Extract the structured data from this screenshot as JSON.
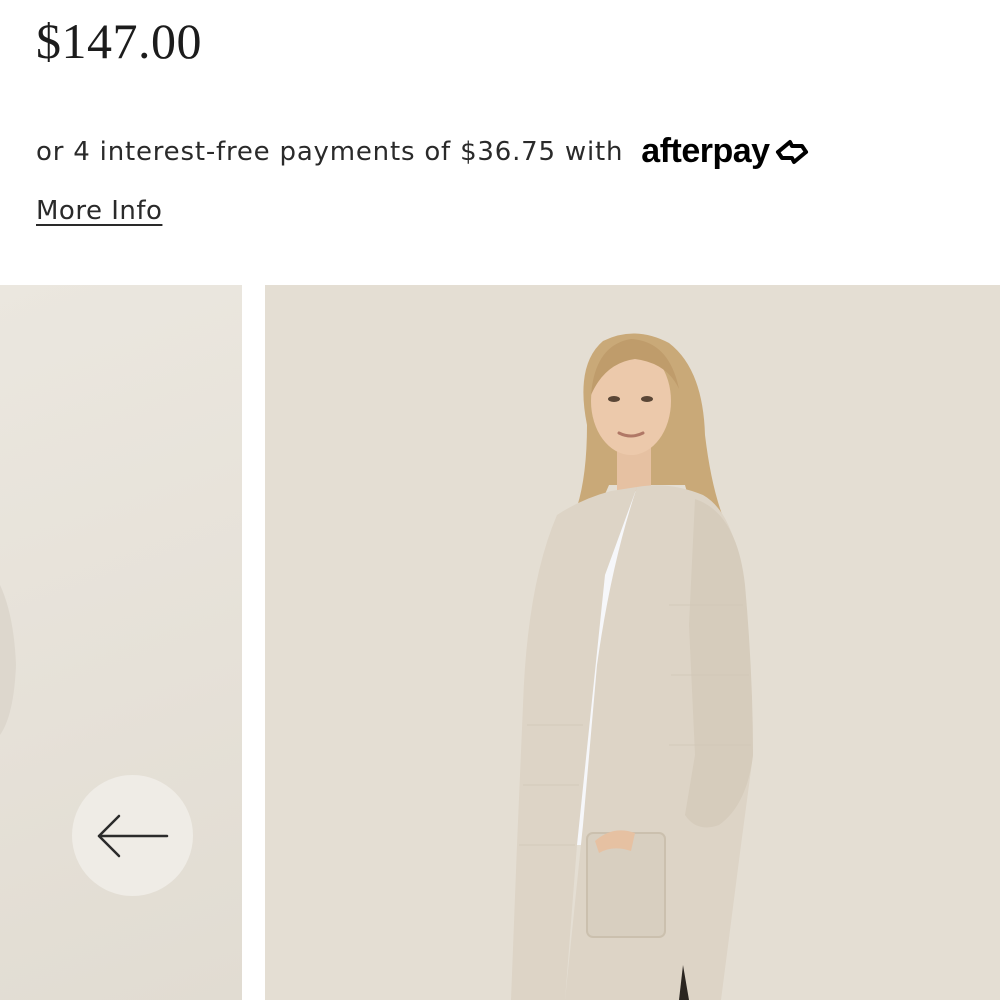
{
  "product": {
    "price": "$147.00"
  },
  "afterpay": {
    "text": "or 4 interest-free payments of $36.75 with",
    "logo_text": "afterpay",
    "more_info_label": "More Info"
  },
  "gallery": {
    "prev_icon": "arrow-left-icon"
  },
  "colors": {
    "background": "#ffffff",
    "text": "#1c1c1c",
    "slide_bg": "#e4ded3",
    "arrow_button_bg": "#efece6"
  }
}
